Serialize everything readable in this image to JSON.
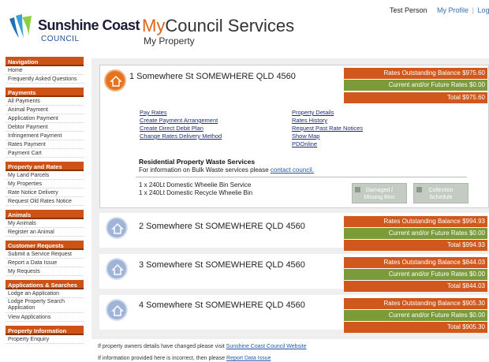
{
  "header": {
    "org_name": "Sunshine Coast",
    "org_sub": "COUNCIL",
    "title_prefix": "My",
    "title_rest": "Council Services",
    "subtitle": "My Property",
    "user_name": "Test Person",
    "profile_link": "My Profile",
    "logout_link": "Log out",
    "separator": "|"
  },
  "sidebar": {
    "sections": [
      {
        "title": "Navigation",
        "items": [
          "Home",
          "Frequently Asked Questions"
        ]
      },
      {
        "title": "Payments",
        "items": [
          "All Payments",
          "Animal Payment",
          "Application Payment",
          "Debtor Payment",
          "Infringement Payment",
          "Rates Payment",
          "Payment Cart"
        ]
      },
      {
        "title": "Property and Rates",
        "items": [
          "My Land Parcels",
          "My Properties",
          "Rate Notice Delivery",
          "Request Old Rates Notice"
        ]
      },
      {
        "title": "Animals",
        "items": [
          "My Animals",
          "Register an Animal"
        ]
      },
      {
        "title": "Customer Requests",
        "items": [
          "Submit a Service Request",
          "Report a Data Issue",
          "My Requests"
        ]
      },
      {
        "title": "Applications & Searches",
        "items": [
          "Lodge an Application",
          "Lodge Property Search Application",
          "View Applications"
        ]
      },
      {
        "title": "Property Information",
        "items": [
          "Property Enquiry"
        ]
      }
    ]
  },
  "properties": [
    {
      "address": "1 Somewhere St SOMEWHERE QLD 4560",
      "outstanding": "Rates Outstanding Balance $975.60",
      "current": "Current and/or Future Rates $0.00",
      "total": "Total $975.60"
    },
    {
      "address": "2 Somewhere St SOMEWHERE  QLD 4560",
      "outstanding": "Rates Outstanding Balance $994.93",
      "current": "Current and/or Future Rates $0.00",
      "total": "Total $994.93"
    },
    {
      "address": "3 Somewhere St SOMEWHERE  QLD 4560",
      "outstanding": "Rates Outstanding Balance $844.03",
      "current": "Current and/or Future Rates $0.00",
      "total": "Total $844.03"
    },
    {
      "address": "4 Somewhere St SOMEWHERE  QLD 4560",
      "outstanding": "Rates Outstanding Balance $905.30",
      "current": "Current and/or Future Rates $0.00",
      "total": "Total $905.30"
    }
  ],
  "detail": {
    "links_left": [
      "Pay Rates",
      "Create Payment Arrangement",
      "Create Direct Debit Plan",
      "Change Rates Delivery Method"
    ],
    "links_right": [
      "Property Details",
      "Rates History",
      "Request Past Rate Notices",
      "Show Map",
      "PDOnline"
    ],
    "waste_title": "Residential Property Waste Services",
    "waste_text": "For information on Bulk Waste services please",
    "waste_link": "contact council.",
    "bins": [
      "1 x 240Lt Domestic Wheelie Bin Service",
      "1 x 240Lt Domestic Recycle Wheelie Bin"
    ],
    "btn_damaged_1": "Damaged /",
    "btn_damaged_2": "Missing Bins",
    "btn_collection_1": "Collection",
    "btn_collection_2": "Schedule"
  },
  "footer": {
    "line1_text": "If property owners details have changed please visit",
    "line1_link": "Sunshine Coast Council Website",
    "line2_text": "If information provided here is incorrect, then please",
    "line2_link": "Report Data Issue"
  },
  "colors": {
    "accent_orange": "#d1581c",
    "accent_green": "#7b9a39",
    "link_blue": "#1b2f7a"
  }
}
